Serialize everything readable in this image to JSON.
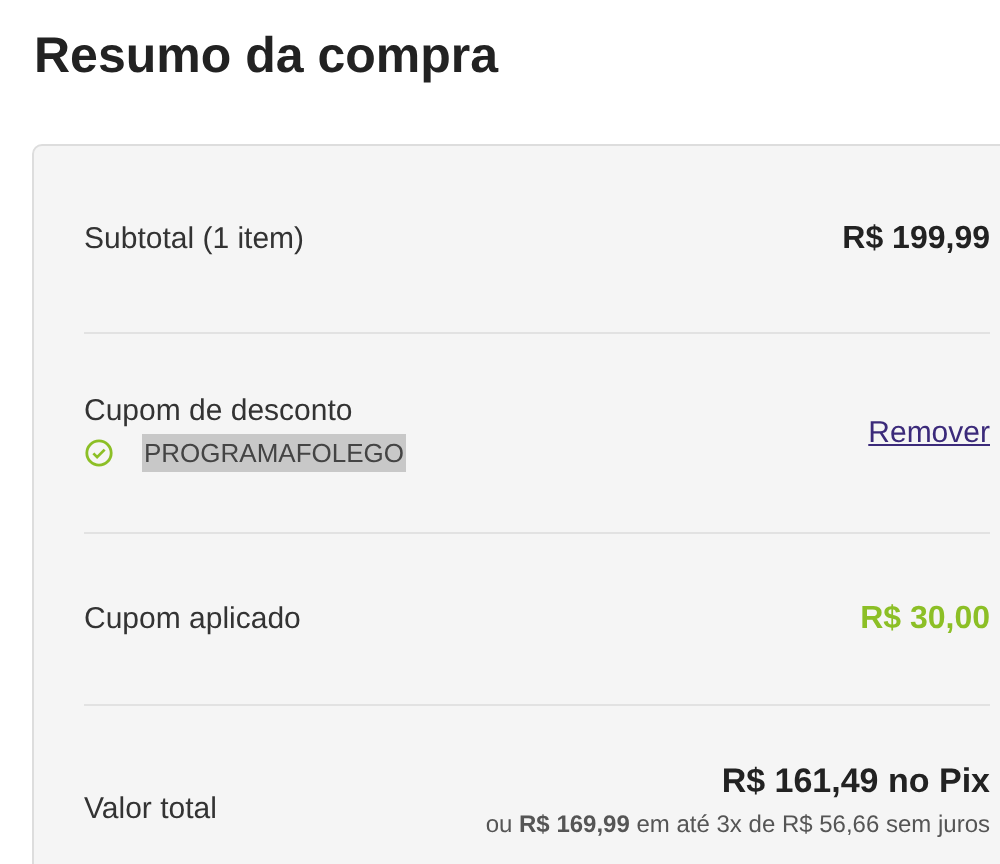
{
  "title": "Resumo da compra",
  "subtotal": {
    "label": "Subtotal (1 item)",
    "value": "R$ 199,99"
  },
  "coupon": {
    "label": "Cupom de desconto",
    "code": "PROGRAMAFOLEGO",
    "applied": true,
    "remove_link": "Remover"
  },
  "discount": {
    "label": "Cupom aplicado",
    "value": "R$ 30,00"
  },
  "total": {
    "label": "Valor total",
    "pix_price": "R$ 161,49 no Pix",
    "installments": "ou **R$ 169,99** em até 3x de R$ 56,66 sem juros"
  }
}
